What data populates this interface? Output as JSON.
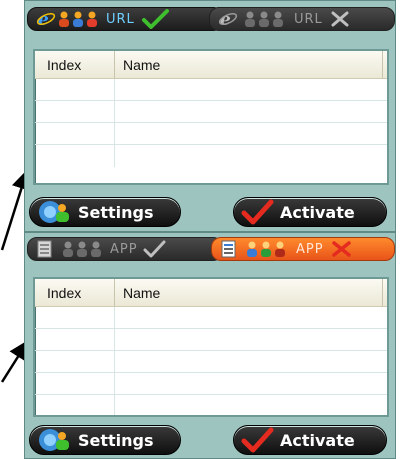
{
  "top_panel": {
    "tabs": [
      {
        "label": "URL",
        "state": "active",
        "icon_main": "ie-logo-icon",
        "icon_users": "users-icon",
        "icon_status": "checkmark-icon"
      },
      {
        "label": "URL",
        "state": "inactive",
        "icon_main": "ie-logo-icon",
        "icon_users": "users-icon",
        "icon_status": "x-icon"
      }
    ],
    "list": {
      "columns": [
        "Index",
        "Name"
      ],
      "rows": [
        [
          "",
          ""
        ],
        [
          "",
          ""
        ],
        [
          "",
          ""
        ],
        [
          "",
          ""
        ]
      ]
    },
    "buttons": {
      "settings": "Settings",
      "activate": "Activate"
    }
  },
  "bottom_panel": {
    "tabs": [
      {
        "label": "APP",
        "state": "inactive",
        "icon_main": "app-window-icon",
        "icon_users": "users-icon",
        "icon_status": "checkmark-icon"
      },
      {
        "label": "APP",
        "state": "active",
        "icon_main": "app-window-icon",
        "icon_users": "users-icon",
        "icon_status": "x-icon"
      }
    ],
    "list": {
      "columns": [
        "Index",
        "Name"
      ],
      "rows": [
        [
          "",
          ""
        ],
        [
          "",
          ""
        ],
        [
          "",
          ""
        ],
        [
          "",
          ""
        ],
        [
          "",
          ""
        ]
      ]
    },
    "buttons": {
      "settings": "Settings",
      "activate": "Activate"
    }
  },
  "colors": {
    "panel_bg": "#9ec4bf",
    "tab_dark": "#1c1c1c",
    "tab_orange": "#e8541a",
    "accent_blue_text": "#6fd0ff",
    "check_green": "#3fbf2e",
    "x_red": "#e52b1f"
  }
}
